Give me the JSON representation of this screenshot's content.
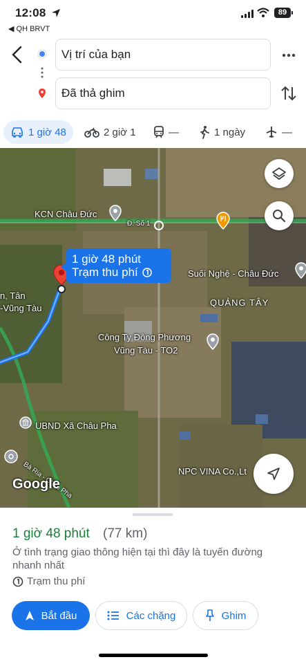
{
  "status": {
    "time": "12:08",
    "back_app": "◀ QH BRVT",
    "battery": "89"
  },
  "search": {
    "from_value": "Vị trí của bạn",
    "to_value": "Đã thả ghim"
  },
  "modes": [
    {
      "label": "1 giờ 48",
      "icon": "car-icon",
      "active": true
    },
    {
      "label": "2 giờ 1",
      "icon": "motorbike-icon"
    },
    {
      "label": "—",
      "icon": "transit-icon"
    },
    {
      "label": "1 ngày",
      "icon": "walk-icon"
    },
    {
      "label": "—",
      "icon": "flight-icon"
    }
  ],
  "map": {
    "labels": {
      "kcn": "KCN Châu Đức",
      "road": "Đ. Số 1",
      "suoi_nghe": "Suối Nghệ - Châu Đức",
      "quang_tay": "QUẢNG TÂY",
      "cong_ty_1": "Công Ty Đông Phương",
      "cong_ty_2": "Vũng Tàu - TO2",
      "left_1": "n, Tân",
      "left_2": "-Vũng Tàu",
      "ubnd": "UBND Xã Châu Pha",
      "ba_ria": "Bà Rịa - Châu Pha",
      "npc": "NPC VINA Co.,Lt",
      "google": "Google"
    },
    "callout": {
      "line1": "1 giờ 48 phút",
      "line2": "Trạm thu phí"
    },
    "colors": {
      "route": "#1a73e8",
      "highway": "#34a853",
      "accent": "#1a73e8"
    }
  },
  "sheet": {
    "duration": "1 giờ 48 phút",
    "distance": "(77 km)",
    "description": "Ở tình trạng giao thông hiện tại thì đây là tuyến đường nhanh nhất",
    "toll": "Trạm thu phí",
    "buttons": {
      "start": "Bắt đầu",
      "stops": "Các chặng",
      "pin": "Ghim"
    }
  }
}
